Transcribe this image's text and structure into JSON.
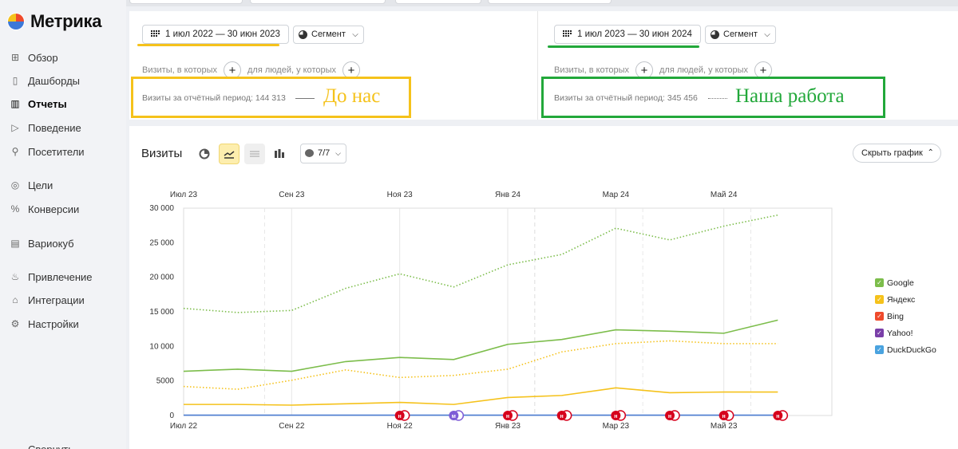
{
  "app": {
    "logo_text": "Метрика"
  },
  "sidebar": {
    "items": [
      {
        "label": "Обзор",
        "icon": "grid-icon",
        "glyph": "⊞"
      },
      {
        "label": "Дашборды",
        "icon": "dashboard-icon",
        "glyph": "▯"
      },
      {
        "label": "Отчеты",
        "icon": "reports-icon",
        "glyph": "▥",
        "active": true
      },
      {
        "label": "Поведение",
        "icon": "play-icon",
        "glyph": "▷"
      },
      {
        "label": "Посетители",
        "icon": "user-icon",
        "glyph": "⚲"
      },
      {
        "label": "Цели",
        "icon": "target-icon",
        "glyph": "◎"
      },
      {
        "label": "Конверсии",
        "icon": "percent-icon",
        "glyph": "%"
      },
      {
        "label": "Вариокуб",
        "icon": "cube-icon",
        "glyph": "▤"
      },
      {
        "label": "Привлечение",
        "icon": "fire-icon",
        "glyph": "♨"
      },
      {
        "label": "Интеграции",
        "icon": "integration-icon",
        "glyph": "⌂"
      },
      {
        "label": "Настройки",
        "icon": "settings-icon",
        "glyph": "⚙"
      },
      {
        "label": "Свернуть",
        "icon": "collapse-icon",
        "glyph": "←"
      }
    ]
  },
  "compare": {
    "left": {
      "date_range": "1 июл 2022 — 30 июн 2023",
      "segment_label": "Сегмент",
      "cond_visits": "Визиты, в которых",
      "cond_people": "для людей, у которых",
      "total_label": "Визиты за отчётный период: 144 313",
      "annotation": "До нас",
      "accent": "#f5c21b"
    },
    "right": {
      "date_range": "1 июл 2023 — 30 июн 2024",
      "segment_label": "Сегмент",
      "cond_visits": "Визиты, в которых",
      "cond_people": "для людей, у которых",
      "total_label": "Визиты за отчётный период: 345 456",
      "annotation": "Наша работа",
      "accent": "#22a83a"
    }
  },
  "chart_panel": {
    "title": "Визиты",
    "attribution_label": "7/7",
    "hide_chart_label": "Скрыть график"
  },
  "chart_data": {
    "type": "line",
    "top_axis_ticks": [
      "Июл 23",
      "Сен 23",
      "Ноя 23",
      "Янв 24",
      "Мар 24",
      "Май 24"
    ],
    "bottom_axis_ticks": [
      "Июл 22",
      "Сен 22",
      "Ноя 22",
      "Янв 23",
      "Мар 23",
      "Май 23"
    ],
    "y_ticks": [
      "30 000",
      "25 000",
      "20 000",
      "15 000",
      "10 000",
      "5000",
      "0"
    ],
    "ylim": [
      0,
      30000
    ],
    "x_months": 12,
    "series": [
      {
        "name": "Google",
        "period": "current",
        "style": "dotted",
        "color": "#7cbd4b",
        "values": [
          15500,
          14900,
          15200,
          18400,
          20500,
          18600,
          21800,
          23300,
          27100,
          25400,
          27400,
          29000
        ]
      },
      {
        "name": "Яндекс",
        "period": "current",
        "style": "dotted",
        "color": "#f5c21b",
        "values": [
          4200,
          3800,
          5100,
          6600,
          5500,
          5800,
          6700,
          9200,
          10400,
          10800,
          10400,
          10400
        ]
      },
      {
        "name": "Google",
        "period": "previous",
        "style": "solid",
        "color": "#7cbd4b",
        "values": [
          6400,
          6700,
          6400,
          7800,
          8400,
          8100,
          10300,
          11000,
          12400,
          12200,
          11900,
          13800
        ]
      },
      {
        "name": "Яндекс",
        "period": "previous",
        "style": "solid",
        "color": "#f5c21b",
        "values": [
          1600,
          1600,
          1500,
          1700,
          1900,
          1600,
          2600,
          2900,
          4000,
          3300,
          3400,
          3400
        ]
      },
      {
        "name": "Bing",
        "period": "previous",
        "style": "solid",
        "color": "#4a7bd0",
        "values": [
          50,
          50,
          50,
          50,
          50,
          50,
          50,
          50,
          50,
          50,
          50,
          50
        ]
      }
    ],
    "legend": [
      {
        "name": "Google",
        "color": "#7cbd4b"
      },
      {
        "name": "Яндекс",
        "color": "#f5c21b"
      },
      {
        "name": "Bing",
        "color": "#ef4a2c"
      },
      {
        "name": "Yahoo!",
        "color": "#7a3fa8"
      },
      {
        "name": "DuckDuckGo",
        "color": "#4aa3df"
      }
    ],
    "markers": [
      {
        "month": 4.0,
        "kind": "н",
        "color": "#d6001c"
      },
      {
        "month": 5.0,
        "kind": "м",
        "color": "#7e5cd6"
      },
      {
        "month": 6.0,
        "kind": "н",
        "color": "#d6001c"
      },
      {
        "month": 7.0,
        "kind": "н",
        "color": "#d6001c"
      },
      {
        "month": 8.0,
        "kind": "н",
        "color": "#d6001c"
      },
      {
        "month": 9.0,
        "kind": "н",
        "color": "#d6001c"
      },
      {
        "month": 10.0,
        "kind": "н",
        "color": "#d6001c"
      },
      {
        "month": 11.0,
        "kind": "н",
        "color": "#d6001c"
      }
    ],
    "grid": true
  }
}
